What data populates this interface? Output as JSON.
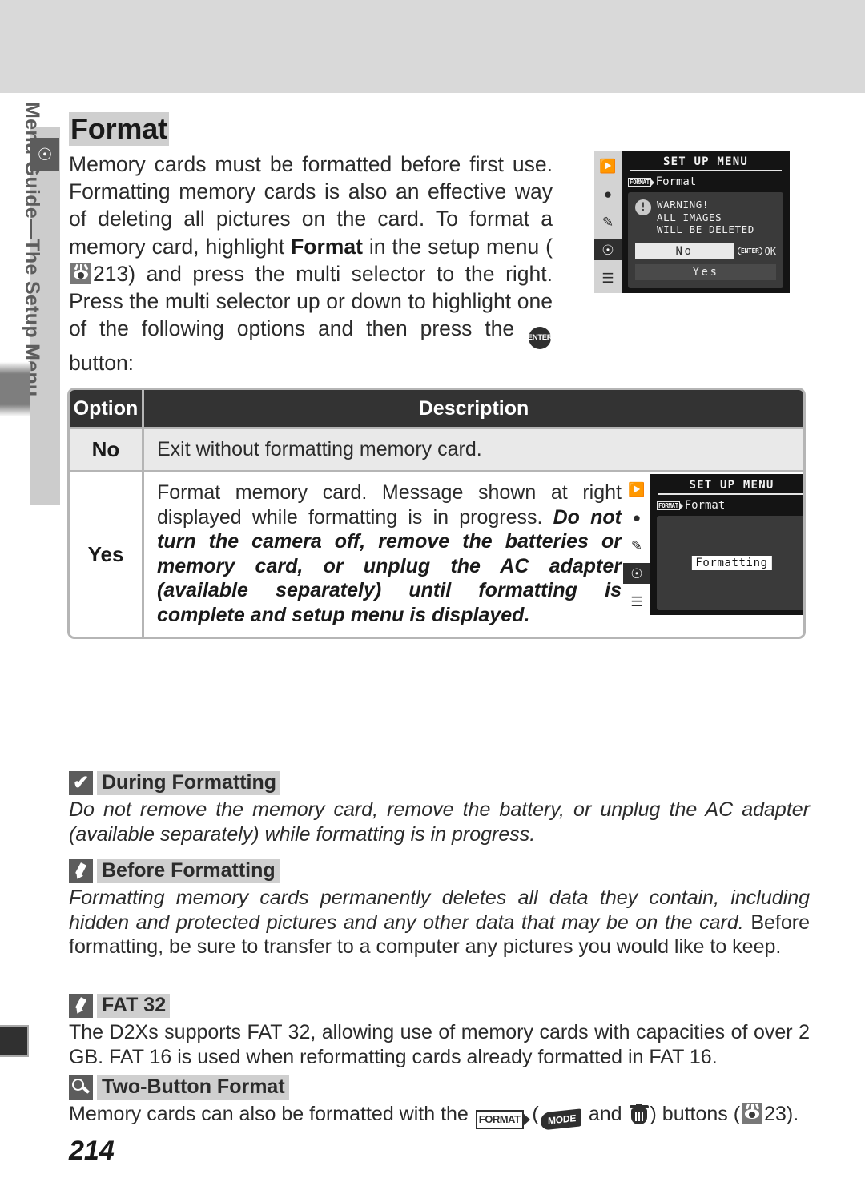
{
  "page": {
    "number": "214",
    "section_tab": "Menu Guide—The Setup Menu",
    "tab_icon": "wrench-icon"
  },
  "heading": {
    "title": "Format"
  },
  "body": {
    "p1_a": "Memory cards must be formatted before first use. Formatting memory cards is also an effective way of deleting all pictures on the card.  To format a memory card, highlight ",
    "p1_bold": "Format",
    "p1_b": " in the setup menu (",
    "p1_ref": "213",
    "p1_c": ") and press the multi selector to the right.  Press the multi selector up or down to highlight one of the following options and then press the ",
    "p1_d": " button:"
  },
  "lcd_warning": {
    "title": "SET UP MENU",
    "badge": "FORMAT",
    "menu_item": "Format",
    "warning_lines": [
      "WARNING!",
      "ALL IMAGES",
      "WILL BE DELETED"
    ],
    "bang": "!",
    "option_selected": "No",
    "option_other": "Yes",
    "enter_pill": "ENTER",
    "ok_label": "OK",
    "rail_icons": [
      "playback-icon",
      "camera-icon",
      "pencil-icon",
      "wrench-icon",
      "recent-icon"
    ]
  },
  "lcd_formatting": {
    "title": "SET UP MENU",
    "badge": "FORMAT",
    "menu_item": "Format",
    "status": "Formatting",
    "rail_icons": [
      "playback-icon",
      "camera-icon",
      "pencil-icon",
      "wrench-icon",
      "recent-icon"
    ]
  },
  "table": {
    "headers": {
      "option": "Option",
      "description": "Description"
    },
    "rows": [
      {
        "option": "No",
        "description": "Exit without formatting memory card."
      },
      {
        "option": "Yes",
        "desc_normal": "Format memory card.  Message shown at right displayed while formatting is in progress.  ",
        "desc_italic": "Do not turn the camera off, remove the batteries or memory card, or unplug the AC adapter (available separately) until formatting is complete and setup menu is displayed."
      }
    ]
  },
  "notes": [
    {
      "icon": "checkmark-icon",
      "title": "During Formatting",
      "body_italic": "Do not remove the memory card, remove the battery, or unplug the AC adapter (available separately) while formatting is in progress.",
      "body_normal": ""
    },
    {
      "icon": "pencil-icon",
      "title": "Before Formatting",
      "body_italic": "Formatting memory cards permanently deletes all data they contain, including hidden and protected pictures and any other data that may be on the card. ",
      "body_normal": "Before formatting, be sure to transfer to a computer any pictures you would like to keep."
    },
    {
      "icon": "pencil-icon",
      "title": "FAT 32",
      "body_italic": "",
      "body_normal": "The D2Xs supports FAT 32, allowing use of memory cards with capacities of over 2 GB. FAT 16 is used when reformatting cards already formatted in FAT 16."
    },
    {
      "icon": "magnifier-icon",
      "title": "Two-Button Format",
      "body_italic": "",
      "body_normal_a": "Memory cards can also be formatted with the ",
      "format_btn": "FORMAT",
      "body_normal_b": " (",
      "mode_btn": "MODE",
      "body_normal_c": " and ",
      "body_normal_d": ") buttons (",
      "page_ref": "23",
      "body_normal_e": ")."
    }
  ],
  "colors": {
    "band": "#d9d9d9",
    "tab": "#cccccc",
    "tab_text": "#5c5c5c",
    "table_header": "#333333",
    "table_border": "#b5b5b5",
    "row_alt": "#e9e9e9",
    "highlight": "#cfcfcf"
  }
}
